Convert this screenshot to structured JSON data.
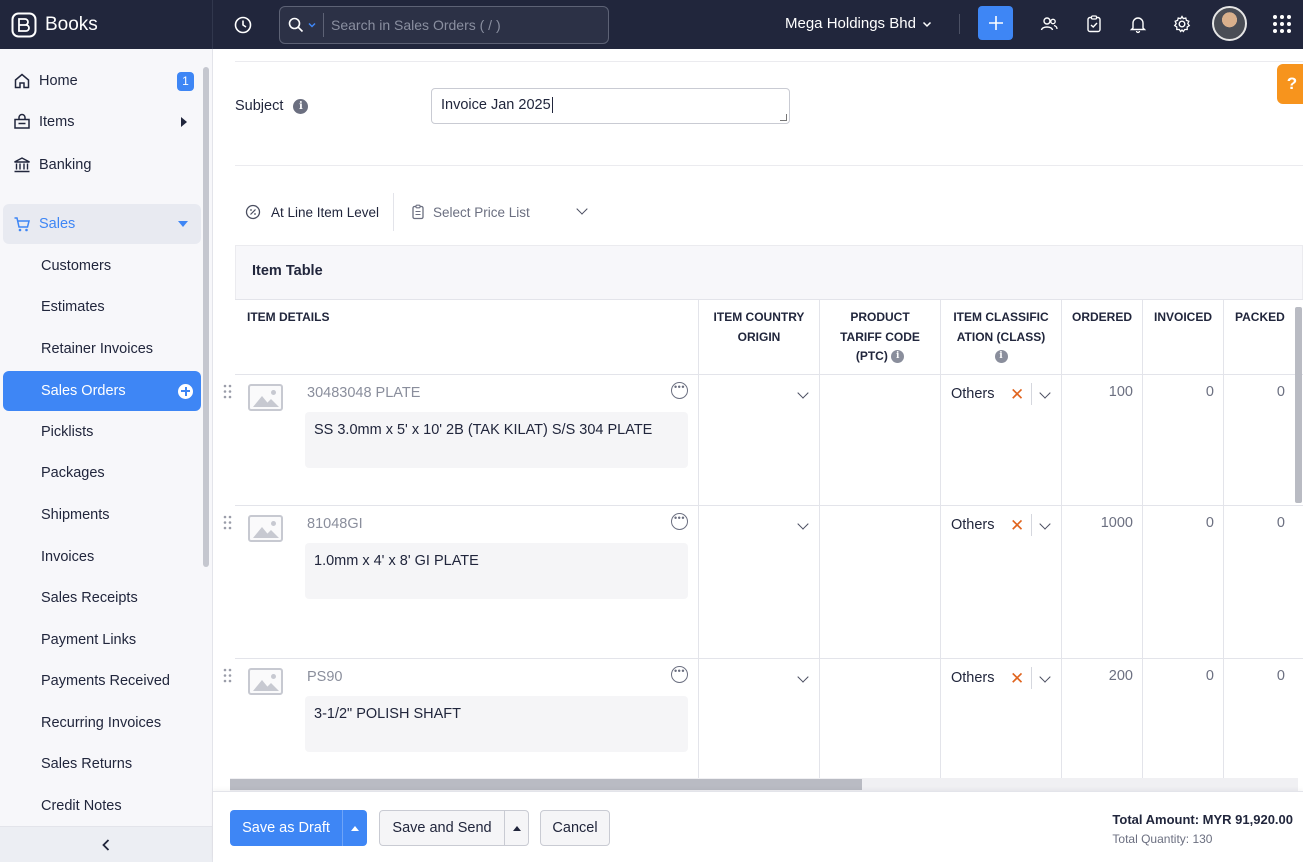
{
  "brand": {
    "name": "Books"
  },
  "search": {
    "placeholder": "Search in Sales Orders ( / )"
  },
  "org": {
    "name": "Mega Holdings Bhd"
  },
  "sidebar": {
    "home": {
      "label": "Home",
      "badge": "1"
    },
    "items": {
      "label": "Items"
    },
    "banking": {
      "label": "Banking"
    },
    "sales": {
      "label": "Sales"
    },
    "sub": [
      "Customers",
      "Estimates",
      "Retainer Invoices",
      "Sales Orders",
      "Picklists",
      "Packages",
      "Shipments",
      "Invoices",
      "Sales Receipts",
      "Payment Links",
      "Payments Received",
      "Recurring Invoices",
      "Sales Returns",
      "Credit Notes"
    ]
  },
  "form": {
    "subject_label": "Subject",
    "subject_value": "Invoice Jan 2025",
    "discount_label": "At Line Item Level",
    "price_list_placeholder": "Select Price List"
  },
  "table": {
    "title": "Item Table",
    "headers": {
      "details": "ITEM DETAILS",
      "country": "ITEM COUNTRY ORIGIN",
      "ptc": "PRODUCT TARIFF CODE (PTC)",
      "class": "ITEM CLASSIFICATION (CLASS)",
      "ordered": "ORDERED",
      "invoiced": "INVOICED",
      "packed": "PACKED"
    },
    "rows": [
      {
        "sku": "30483048 PLATE",
        "description": "SS 3.0mm x 5' x 10' 2B (TAK KILAT) S/S 304 PLATE",
        "classification": "Others",
        "ordered": "100",
        "invoiced": "0",
        "packed": "0"
      },
      {
        "sku": "81048GI",
        "description": "1.0mm x 4' x 8' GI PLATE",
        "classification": "Others",
        "ordered": "1000",
        "invoiced": "0",
        "packed": "0"
      },
      {
        "sku": "PS90",
        "description": "3-1/2\" POLISH SHAFT",
        "classification": "Others",
        "ordered": "200",
        "invoiced": "0",
        "packed": "0"
      }
    ]
  },
  "footer": {
    "save_draft": "Save as Draft",
    "save_send": "Save and Send",
    "cancel": "Cancel",
    "total_amount": "Total Amount: MYR 91,920.00",
    "total_quantity": "Total Quantity: 130"
  },
  "help": {
    "label": "?"
  },
  "colors": {
    "accent": "#3e86f5",
    "topbar": "#21263c",
    "help": "#f7941d",
    "remove": "#e0641e"
  }
}
